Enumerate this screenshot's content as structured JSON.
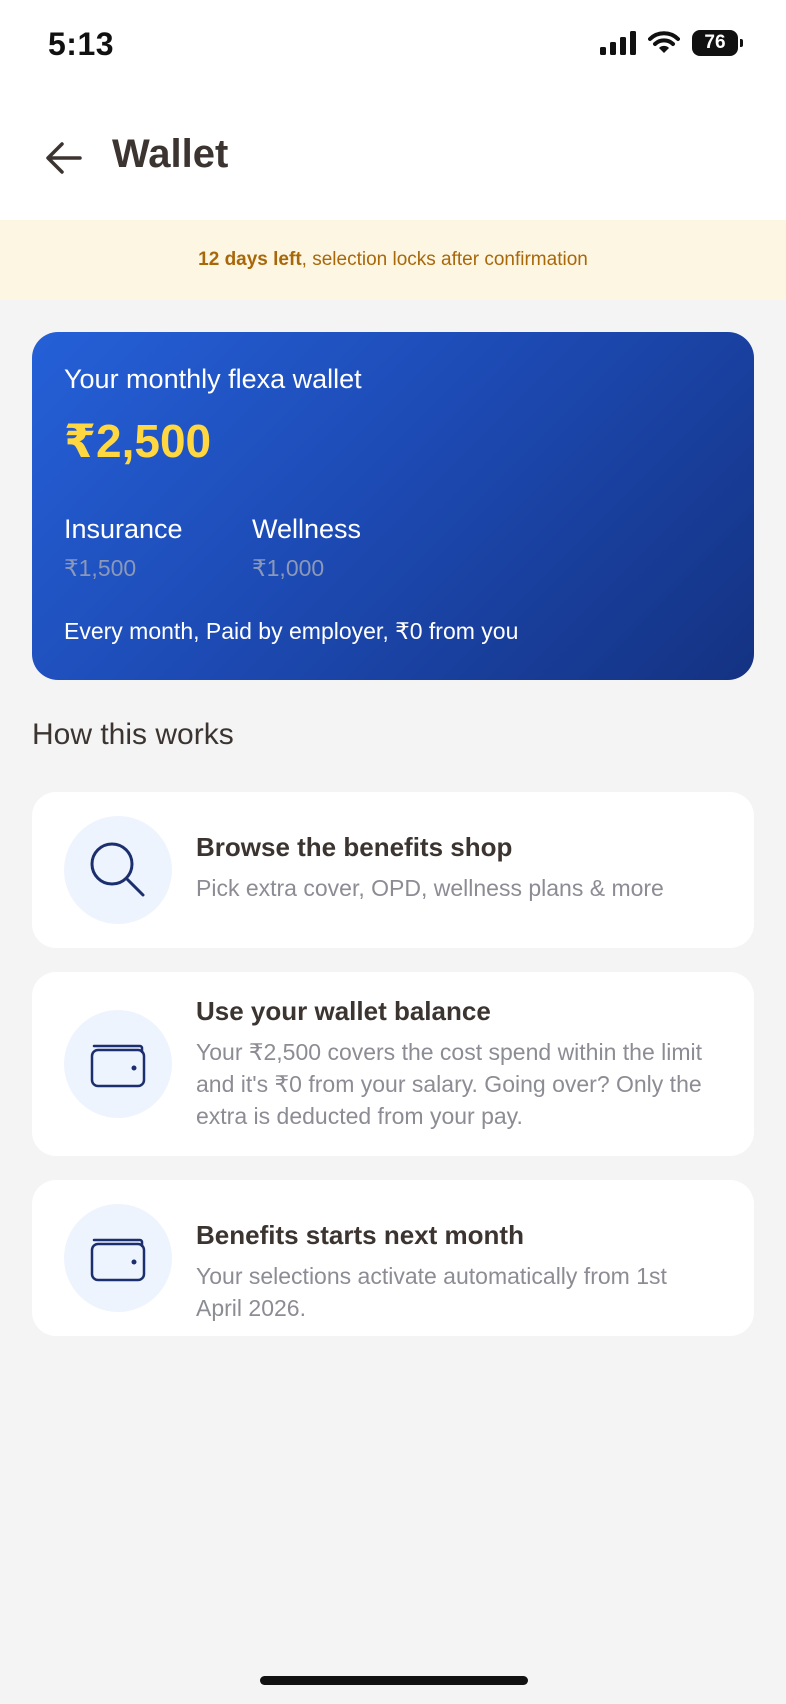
{
  "status_bar": {
    "time": "5:13",
    "battery": "76"
  },
  "header": {
    "title": "Wallet"
  },
  "banner": {
    "bold": "12 days left",
    "rest": ", selection locks after confirmation"
  },
  "wallet": {
    "title": "Your monthly flexa wallet",
    "amount": "₹2,500",
    "breakdown": [
      {
        "label": "Insurance",
        "value": "₹1,500"
      },
      {
        "label": "Wellness",
        "value": "₹1,000"
      }
    ],
    "footer": "Every month, Paid by employer, ₹0 from you",
    "colors": {
      "gradient_start": "#2560d8",
      "gradient_end": "#143282",
      "amount": "#ffd740"
    }
  },
  "how_it_works": {
    "title": "How this works",
    "steps": [
      {
        "icon": "search-icon",
        "title": "Browse the benefits shop",
        "desc": "Pick extra cover, OPD, wellness plans & more"
      },
      {
        "icon": "wallet-icon",
        "title": "Use your wallet balance",
        "desc": "Your ₹2,500 covers the cost spend within the limit and it's ₹0 from your salary. Going over? Only the extra is deducted from your pay."
      },
      {
        "icon": "wallet-icon",
        "title": "Benefits starts next month",
        "desc": "Your selections activate automatically from 1st April 2026."
      }
    ]
  }
}
